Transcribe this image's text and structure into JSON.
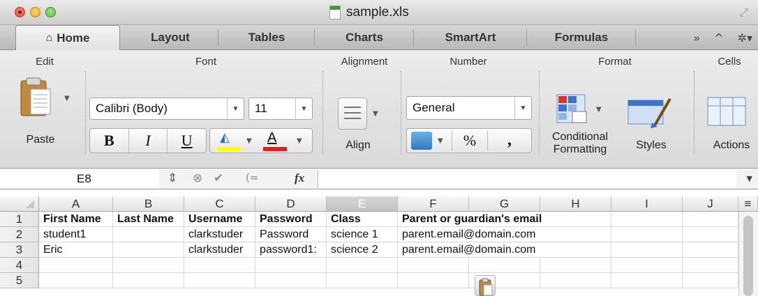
{
  "window": {
    "title": "sample.xls",
    "close_icon": "close-icon",
    "minimize_icon": "minimize-icon",
    "maximize_icon": "maximize-icon",
    "fullscreen_icon": "fullscreen-icon"
  },
  "tabs": [
    {
      "label": "Home",
      "active": true,
      "icon": "home-icon"
    },
    {
      "label": "Layout"
    },
    {
      "label": "Tables"
    },
    {
      "label": "Charts"
    },
    {
      "label": "SmartArt"
    },
    {
      "label": "Formulas"
    }
  ],
  "tab_tools": {
    "more": "»",
    "collapse": "^",
    "settings": "gear-icon"
  },
  "ribbon": {
    "groups": [
      "Edit",
      "Font",
      "Alignment",
      "Number",
      "Format",
      "Cells"
    ],
    "paste_label": "Paste",
    "font_name": "Calibri (Body)",
    "font_size": "11",
    "bold": "B",
    "italic": "I",
    "underline": "U",
    "highlight_color": "#ffff00",
    "font_color": "#e02020",
    "align_label": "Align",
    "number_format": "General",
    "percent": "%",
    "comma": ",",
    "conditional_formatting_line1": "Conditional",
    "conditional_formatting_line2": "Formatting",
    "styles_label": "Styles",
    "actions_label": "Actions"
  },
  "formula_bar": {
    "name_box": "E8",
    "fx": "fx",
    "value": ""
  },
  "sheet": {
    "selected_cell": "E8",
    "columns": [
      "A",
      "B",
      "C",
      "D",
      "E",
      "F",
      "G",
      "H",
      "I",
      "J"
    ],
    "rows": [
      "1",
      "2",
      "3",
      "4",
      "5"
    ],
    "cells": {
      "r1": [
        "First Name",
        "Last Name",
        "Username",
        "Password",
        "Class",
        "Parent or guardian's email"
      ],
      "r2": [
        "student1",
        "",
        "clarkstuder",
        "Password",
        "science 1",
        "parent.email@domain.com"
      ],
      "r3": [
        "Eric",
        "",
        "clarkstuder",
        "password1:",
        "science 2",
        "parent.email@domain.com"
      ]
    }
  }
}
